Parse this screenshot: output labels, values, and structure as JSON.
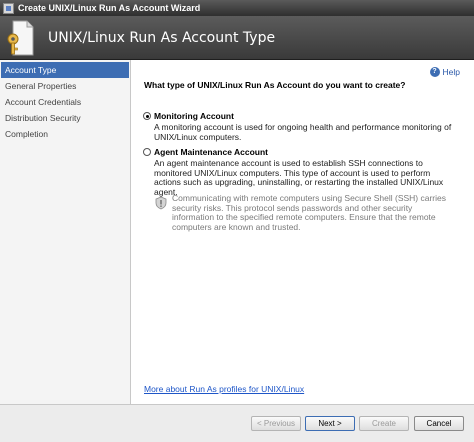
{
  "window": {
    "title": "Create UNIX/Linux Run As Account Wizard"
  },
  "header": {
    "title": "UNIX/Linux Run As Account Type",
    "icon": "key-document-icon"
  },
  "nav": {
    "items": [
      {
        "label": "Account Type",
        "active": true
      },
      {
        "label": "General Properties"
      },
      {
        "label": "Account Credentials"
      },
      {
        "label": "Distribution Security"
      },
      {
        "label": "Completion"
      }
    ]
  },
  "main": {
    "help_label": "Help",
    "question": "What type of UNIX/Linux Run As Account do you want to create?",
    "options": [
      {
        "label": "Monitoring Account",
        "selected": true,
        "description": "A monitoring account is used for ongoing health and performance monitoring of UNIX/Linux computers."
      },
      {
        "label": "Agent Maintenance Account",
        "selected": false,
        "description": "An agent maintenance account is used to establish SSH connections to monitored UNIX/Linux computers. This type of account is used to perform actions such as upgrading, uninstalling, or restarting the installed UNIX/Linux agent."
      }
    ],
    "warning": "Communicating with remote computers using Secure Shell (SSH) carries security risks. This protocol sends passwords and other security information to the specified remote computers. Ensure that the remote computers are known and trusted.",
    "more_link": "More about Run As profiles for UNIX/Linux"
  },
  "footer": {
    "previous": "< Previous",
    "next": "Next >",
    "create": "Create",
    "cancel": "Cancel"
  },
  "colors": {
    "accent": "#3d6db3",
    "header_bg": "#4a4a4a",
    "link": "#1e56c8"
  }
}
